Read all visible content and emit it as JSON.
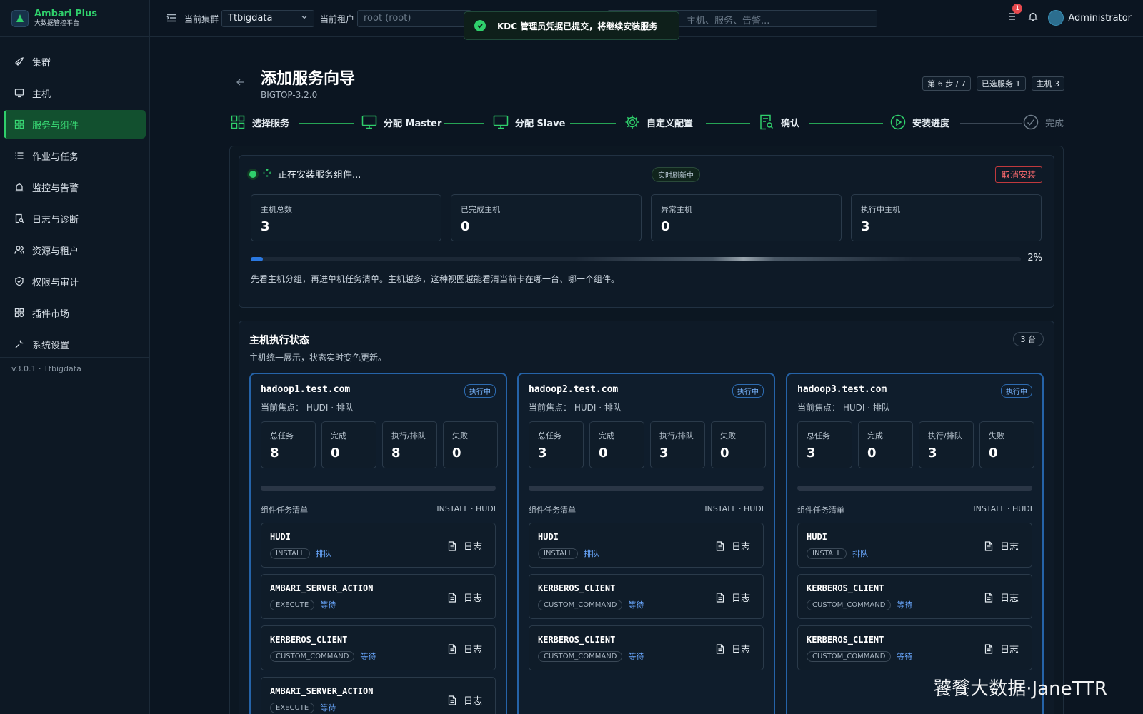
{
  "brand": {
    "title": "Ambari Plus",
    "subtitle": "大数据管控平台"
  },
  "sidebar": {
    "items": [
      {
        "label": "集群",
        "icon": "rocket-icon"
      },
      {
        "label": "主机",
        "icon": "monitor-icon"
      },
      {
        "label": "服务与组件",
        "icon": "grid-icon",
        "active": true
      },
      {
        "label": "作业与任务",
        "icon": "list-icon"
      },
      {
        "label": "监控与告警",
        "icon": "alarm-icon"
      },
      {
        "label": "日志与诊断",
        "icon": "file-search-icon"
      },
      {
        "label": "资源与租户",
        "icon": "users-icon"
      },
      {
        "label": "权限与审计",
        "icon": "shield-icon"
      },
      {
        "label": "插件市场",
        "icon": "puzzle-icon"
      },
      {
        "label": "系统设置",
        "icon": "wrench-icon"
      }
    ],
    "version": "v3.0.1 · Ttbigdata"
  },
  "topbar": {
    "cluster_label": "当前集群",
    "cluster_value": "Ttbigdata",
    "tenant_label": "当前租户",
    "tenant_placeholder": "root (root)",
    "search_placeholder": "主机、服务、告警...",
    "notification_count": "1",
    "user": "Administrator"
  },
  "toast": {
    "text": "KDC 管理员凭据已提交，将继续安装服务"
  },
  "wizard": {
    "title": "添加服务向导",
    "subtitle": "BIGTOP-3.2.0",
    "chips": [
      "第 6 步 / 7",
      "已选服务 1",
      "主机 3"
    ],
    "steps": [
      {
        "label": "选择服务",
        "icon": "grid-icon"
      },
      {
        "label": "分配 Master",
        "icon": "monitor-icon"
      },
      {
        "label": "分配 Slave",
        "icon": "monitor-icon"
      },
      {
        "label": "自定义配置",
        "icon": "gear-icon"
      },
      {
        "label": "确认",
        "icon": "file-search-icon"
      },
      {
        "label": "安装进度",
        "icon": "play-circle-icon"
      },
      {
        "label": "完成",
        "icon": "check-circle-icon"
      }
    ]
  },
  "progress": {
    "status": "正在安装服务组件...",
    "live": "实时刷新中",
    "cancel": "取消安装",
    "stats": [
      {
        "label": "主机总数",
        "value": "3"
      },
      {
        "label": "已完成主机",
        "value": "0"
      },
      {
        "label": "异常主机",
        "value": "0"
      },
      {
        "label": "执行中主机",
        "value": "3"
      }
    ],
    "percent": 2,
    "percent_text": "2%",
    "hint": "先看主机分组，再进单机任务清单。主机越多，这种视图越能看清当前卡在哪一台、哪一个组件。"
  },
  "hosts_section": {
    "title": "主机执行状态",
    "subtitle": "主机统一展示，状态实时变色更新。",
    "count": "3 台",
    "mini_labels": [
      "总任务",
      "完成",
      "执行/排队",
      "失败"
    ],
    "task_list_label": "组件任务清单",
    "log_label": "日志",
    "hosts": [
      {
        "name": "hadoop1.test.com",
        "badge": "执行中",
        "focus": "当前焦点：  HUDI · 排队",
        "stats": [
          "8",
          "0",
          "8",
          "0"
        ],
        "task_right": "INSTALL · HUDI",
        "tasks": [
          {
            "name": "HUDI",
            "cmd": "INSTALL",
            "state": "排队"
          },
          {
            "name": "AMBARI_SERVER_ACTION",
            "cmd": "EXECUTE",
            "state": "等待"
          },
          {
            "name": "KERBEROS_CLIENT",
            "cmd": "CUSTOM_COMMAND",
            "state": "等待"
          },
          {
            "name": "AMBARI_SERVER_ACTION",
            "cmd": "EXECUTE",
            "state": "等待"
          }
        ]
      },
      {
        "name": "hadoop2.test.com",
        "badge": "执行中",
        "focus": "当前焦点：  HUDI · 排队",
        "stats": [
          "3",
          "0",
          "3",
          "0"
        ],
        "task_right": "INSTALL · HUDI",
        "tasks": [
          {
            "name": "HUDI",
            "cmd": "INSTALL",
            "state": "排队"
          },
          {
            "name": "KERBEROS_CLIENT",
            "cmd": "CUSTOM_COMMAND",
            "state": "等待"
          },
          {
            "name": "KERBEROS_CLIENT",
            "cmd": "CUSTOM_COMMAND",
            "state": "等待"
          }
        ]
      },
      {
        "name": "hadoop3.test.com",
        "badge": "执行中",
        "focus": "当前焦点：  HUDI · 排队",
        "stats": [
          "3",
          "0",
          "3",
          "0"
        ],
        "task_right": "INSTALL · HUDI",
        "tasks": [
          {
            "name": "HUDI",
            "cmd": "INSTALL",
            "state": "排队"
          },
          {
            "name": "KERBEROS_CLIENT",
            "cmd": "CUSTOM_COMMAND",
            "state": "等待"
          },
          {
            "name": "KERBEROS_CLIENT",
            "cmd": "CUSTOM_COMMAND",
            "state": "等待"
          }
        ]
      }
    ]
  },
  "watermark": "饕餮大数据·JaneTTR",
  "colors": {
    "accent": "#2fcf6b",
    "active_bg": "#12502f",
    "progress": "#2a78e0",
    "running": "#2563a8",
    "danger": "#ff6b6f"
  }
}
